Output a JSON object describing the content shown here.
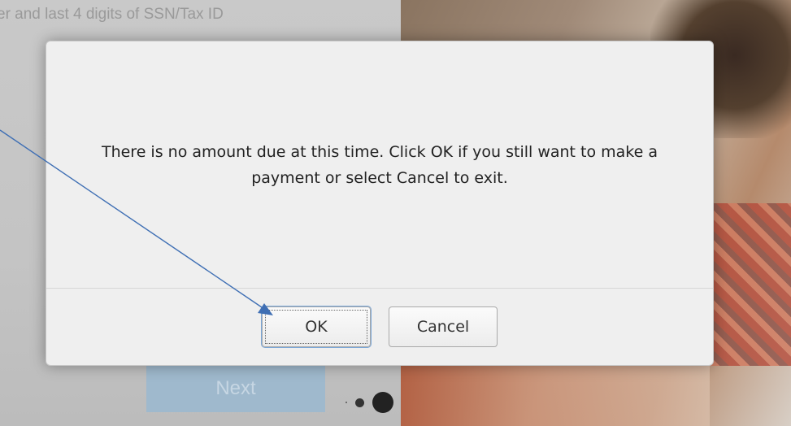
{
  "background": {
    "hint_text": "er and last 4 digits of SSN/Tax ID",
    "next_button_label": "Next"
  },
  "dialog": {
    "message": "There is no amount due at this time. Click OK if you still want to make a payment or select Cancel to exit.",
    "ok_label": "OK",
    "cancel_label": "Cancel"
  },
  "colors": {
    "annotation_arrow": "#3f6fb4",
    "dialog_background": "#efefef",
    "next_button": "#9fb9cd"
  },
  "icons": [
    "annotation-arrow-icon",
    "carousel-dot-icon"
  ]
}
